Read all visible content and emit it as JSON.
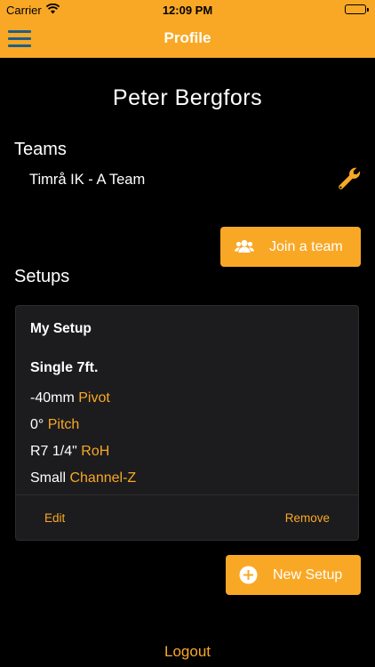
{
  "status_bar": {
    "carrier": "Carrier",
    "time": "12:09 PM",
    "battery_level": 1.0
  },
  "nav": {
    "title": "Profile",
    "menu_icon": "hamburger-icon"
  },
  "profile": {
    "name": "Peter Bergfors"
  },
  "teams": {
    "heading": "Teams",
    "items": [
      {
        "name": "Timrå IK - A Team",
        "edit_icon": "wrench-icon"
      }
    ],
    "join_label": "Join a team",
    "join_icon": "users-icon"
  },
  "setups": {
    "heading": "Setups",
    "items": [
      {
        "name": "My Setup",
        "type": "Single 7ft.",
        "rows": [
          {
            "value": "-40mm",
            "key": "Pivot"
          },
          {
            "value": "0°",
            "key": "Pitch"
          },
          {
            "value": "R7 1/4\"",
            "key": "RoH"
          },
          {
            "value": "Small",
            "key": "Channel-Z"
          }
        ],
        "edit_label": "Edit",
        "remove_label": "Remove"
      }
    ],
    "new_label": "New Setup",
    "new_icon": "plus-circle-icon"
  },
  "logout_label": "Logout",
  "colors": {
    "accent": "#f9a825",
    "background": "#000000",
    "card": "#1c1c1e"
  }
}
